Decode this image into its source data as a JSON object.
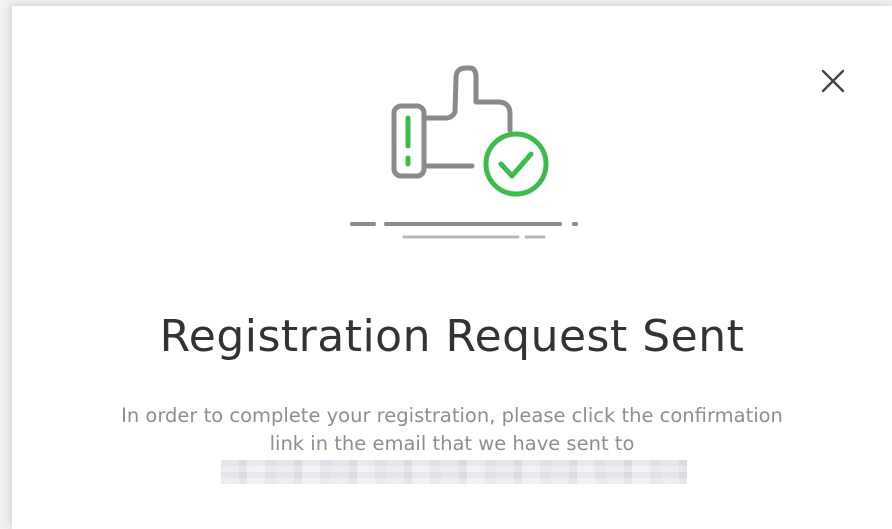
{
  "dialog": {
    "title": "Registration Request Sent",
    "message_line1": "In order to complete your registration, please click the confirmation",
    "message_line2": "link in the email that we have sent to",
    "close_icon": "close-icon",
    "illustration_icon": "thumbs-up-check-icon",
    "email_redacted": true
  },
  "colors": {
    "accent_green": "#3dbb4b",
    "icon_gray": "#8a8a8a",
    "title": "#333333",
    "message": "#8e8e8e"
  }
}
